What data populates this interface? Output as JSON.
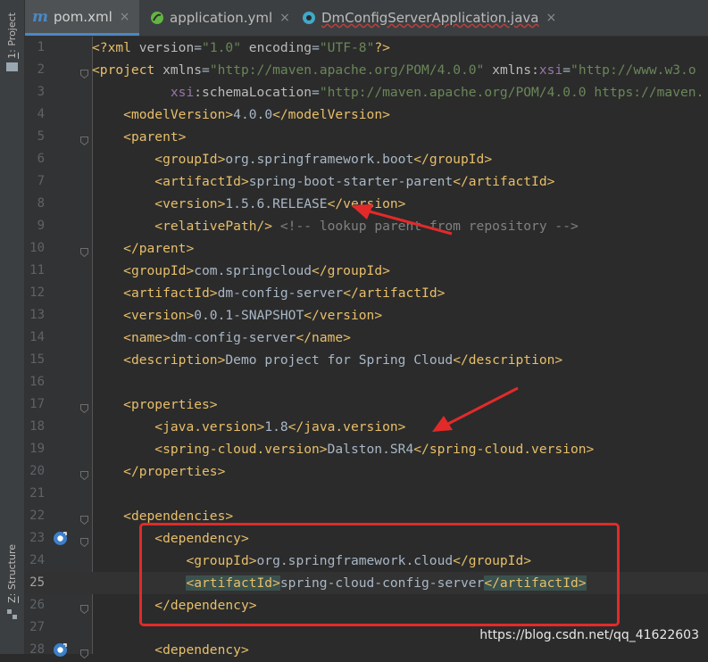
{
  "tool_windows": {
    "project": {
      "number": "1",
      "label": "Project"
    },
    "structure": {
      "number": "Z",
      "label": "Structure"
    }
  },
  "tabs": [
    {
      "label": "pom.xml",
      "icon": "maven-m-icon",
      "active": true
    },
    {
      "label": "application.yml",
      "icon": "spring-leaf-icon",
      "active": false
    },
    {
      "label": "DmConfigServerApplication.java",
      "icon": "spring-boot-class-icon",
      "active": false,
      "error_underline": true
    }
  ],
  "close_glyph": "×",
  "current_line": 25,
  "code_lines": [
    {
      "n": "1",
      "html": "<span class='t'>&lt;?xml</span> <span class='a'>version</span>=<span class='v'>\"1.0\"</span> <span class='a'>encoding</span>=<span class='v'>\"UTF-8\"</span><span class='t'>?&gt;</span>"
    },
    {
      "n": "2",
      "html": "<span class='t'>&lt;project</span> <span class='a'>xmlns</span>=<span class='v'>\"http://maven.apache.org/POM/4.0.0\"</span> <span class='a'>xmlns:</span><span class='ns'>xsi</span>=<span class='v'>\"http://www.w3.o</span>"
    },
    {
      "n": "3",
      "html": "          <span class='ns'>xsi</span><span class='a'>:schemaLocation</span>=<span class='v'>\"http://maven.apache.org/POM/4.0.0 https://maven.</span>"
    },
    {
      "n": "4",
      "html": "    <span class='t'>&lt;modelVersion&gt;</span>4.0.0<span class='t'>&lt;/modelVersion&gt;</span>"
    },
    {
      "n": "5",
      "html": "    <span class='t'>&lt;parent&gt;</span>"
    },
    {
      "n": "6",
      "html": "        <span class='t'>&lt;groupId&gt;</span>org.springframework.boot<span class='t'>&lt;/groupId&gt;</span>"
    },
    {
      "n": "7",
      "html": "        <span class='t'>&lt;artifactId&gt;</span>spring-boot-starter-parent<span class='t'>&lt;/artifactId&gt;</span>"
    },
    {
      "n": "8",
      "html": "        <span class='t'>&lt;version&gt;</span>1.5.6.RELEASE<span class='t'>&lt;/version&gt;</span>"
    },
    {
      "n": "9",
      "html": "        <span class='t'>&lt;relativePath/&gt;</span> <span class='cm'>&lt;!-- lookup parent from repository --&gt;</span>"
    },
    {
      "n": "10",
      "html": "    <span class='t'>&lt;/parent&gt;</span>"
    },
    {
      "n": "11",
      "html": "    <span class='t'>&lt;groupId&gt;</span>com.springcloud<span class='t'>&lt;/groupId&gt;</span>"
    },
    {
      "n": "12",
      "html": "    <span class='t'>&lt;artifactId&gt;</span>dm-config-server<span class='t'>&lt;/artifactId&gt;</span>"
    },
    {
      "n": "13",
      "html": "    <span class='t'>&lt;version&gt;</span>0.0.1-SNAPSHOT<span class='t'>&lt;/version&gt;</span>"
    },
    {
      "n": "14",
      "html": "    <span class='t'>&lt;name&gt;</span>dm-config-server<span class='t'>&lt;/name&gt;</span>"
    },
    {
      "n": "15",
      "html": "    <span class='t'>&lt;description&gt;</span>Demo project for Spring Cloud<span class='t'>&lt;/description&gt;</span>"
    },
    {
      "n": "16",
      "html": ""
    },
    {
      "n": "17",
      "html": "    <span class='t'>&lt;properties&gt;</span>"
    },
    {
      "n": "18",
      "html": "        <span class='t'>&lt;java.version&gt;</span>1.8<span class='t'>&lt;/java.version&gt;</span>"
    },
    {
      "n": "19",
      "html": "        <span class='t'>&lt;spring-cloud.version&gt;</span>Dalston.SR4<span class='t'>&lt;/spring-cloud.version&gt;</span>"
    },
    {
      "n": "20",
      "html": "    <span class='t'>&lt;/properties&gt;</span>"
    },
    {
      "n": "21",
      "html": ""
    },
    {
      "n": "22",
      "html": "    <span class='t'>&lt;dependencies&gt;</span>"
    },
    {
      "n": "23",
      "html": "        <span class='t'>&lt;dependency&gt;</span>"
    },
    {
      "n": "24",
      "html": "            <span class='t'>&lt;groupId&gt;</span>org.springframework.cloud<span class='t'>&lt;/groupId&gt;</span>"
    },
    {
      "n": "25",
      "html": "            <span class='t hl'>&lt;artifactId&gt;</span>spring-cloud-config-server<span class='t hl'>&lt;/artifactId&gt;</span>"
    },
    {
      "n": "26",
      "html": "        <span class='t'>&lt;/dependency&gt;</span>"
    },
    {
      "n": "27",
      "html": ""
    },
    {
      "n": "28",
      "html": "        <span class='t'>&lt;dependency&gt;</span>"
    }
  ],
  "folds": [
    "2",
    "5",
    "10",
    "17",
    "20",
    "22",
    "23",
    "26",
    "28"
  ],
  "gutter_icons": {
    "23": "spring-bean-icon",
    "28": "spring-bean-icon"
  },
  "watermark": "https://blog.csdn.net/qq_41622603",
  "colors": {
    "tag": "#e8bf6a",
    "attr_value": "#6a8759",
    "namespace": "#9876aa",
    "comment": "#808080",
    "annotation_red": "#e22a2a"
  }
}
